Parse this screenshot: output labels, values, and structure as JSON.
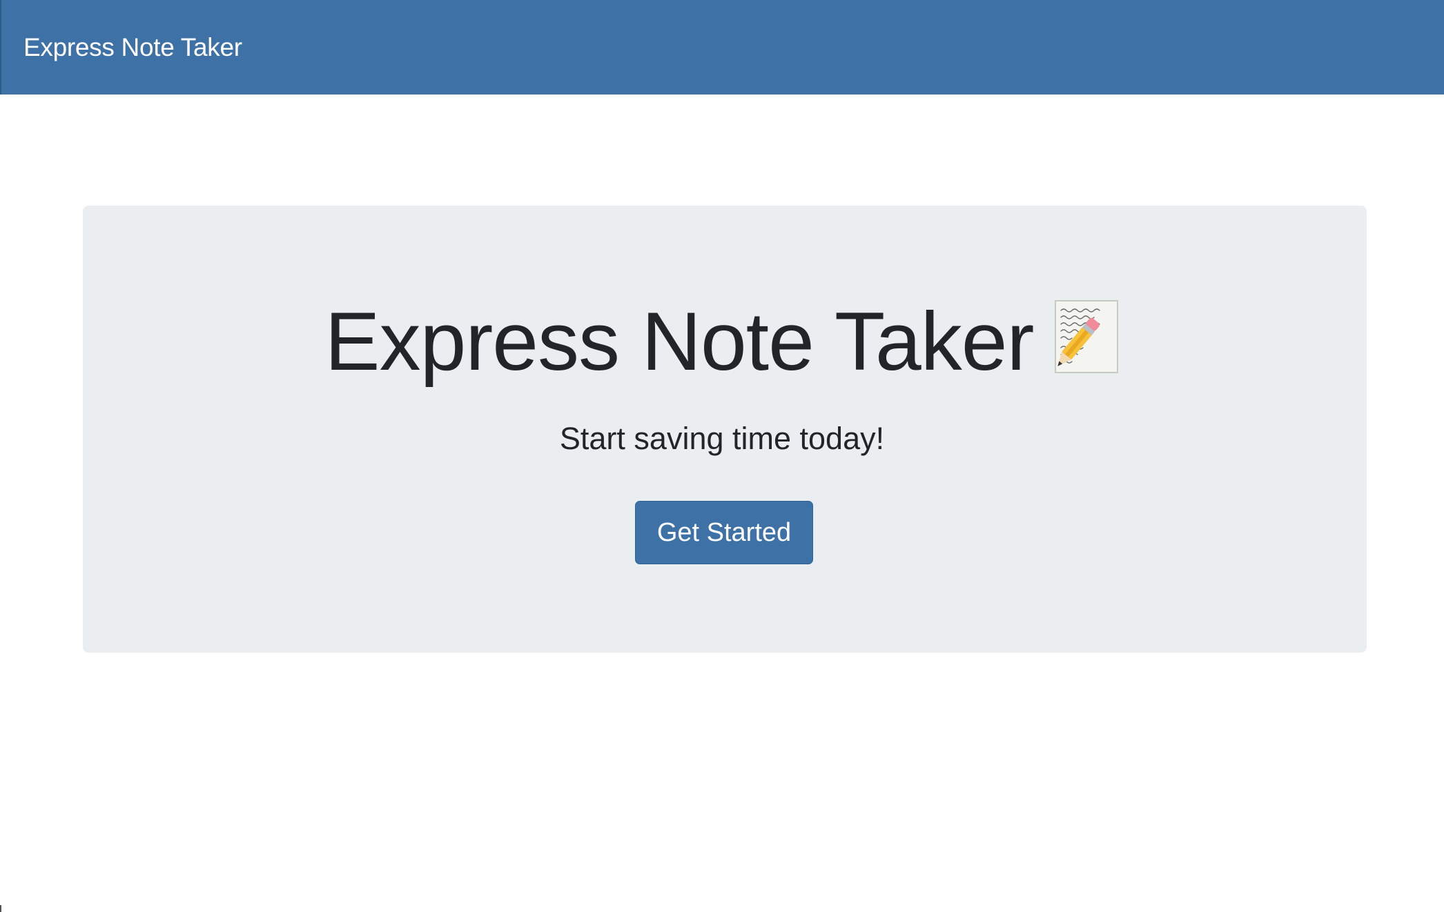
{
  "navbar": {
    "brand": "Express Note Taker"
  },
  "hero": {
    "title": "Express Note Taker",
    "icon": "memo-pencil-icon",
    "subtitle": "Start saving time today!",
    "cta_label": "Get Started"
  },
  "colors": {
    "navbar_bg": "#3e72a7",
    "jumbotron_bg": "#ebeef0",
    "button_bg": "#3e72a7",
    "text": "#212529"
  }
}
